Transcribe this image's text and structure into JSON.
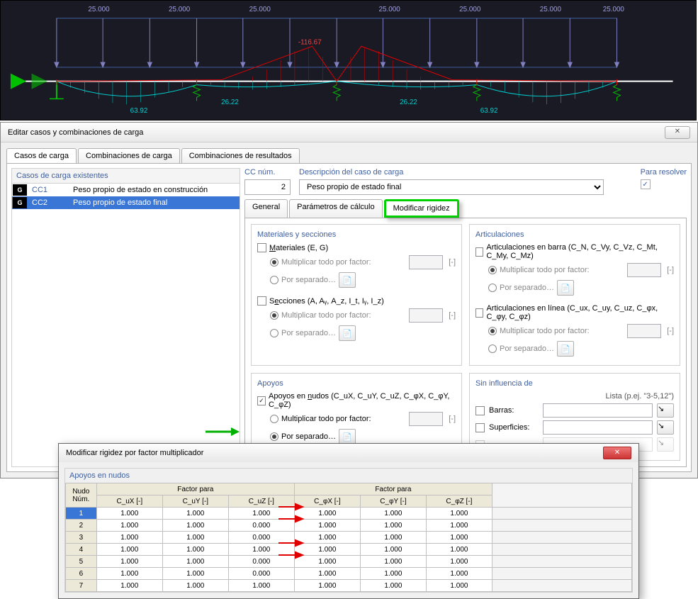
{
  "viewport": {
    "load_labels": [
      "25.000",
      "25.000",
      "25.000",
      "25.000",
      "25.000",
      "25.000",
      "25.000"
    ],
    "moment_peak": "-116.67",
    "deflect_vals": [
      "63.92",
      "26.22",
      "26.22",
      "63.92"
    ]
  },
  "dialog": {
    "title": "Editar casos y combinaciones de carga",
    "close": "✕",
    "tabs": {
      "t1": "Casos de carga",
      "t2": "Combinaciones de carga",
      "t3": "Combinaciones de resultados"
    },
    "left": {
      "header": "Casos de carga existentes",
      "rows": [
        {
          "tag": "G",
          "id": "CC1",
          "desc": "Peso propio de estado en construcción"
        },
        {
          "tag": "G",
          "id": "CC2",
          "desc": "Peso propio de estado final"
        }
      ]
    },
    "top": {
      "cc_num_label": "CC núm.",
      "cc_num": "2",
      "desc_label": "Descripción del caso de carga",
      "desc_value": "Peso propio de estado final",
      "solve_label": "Para resolver"
    },
    "subtabs": {
      "s1": "General",
      "s2": "Parámetros de cálculo",
      "s3": "Modificar rigidez"
    },
    "groups": {
      "mat": {
        "title": "Materiales y secciones",
        "chk1": "Materiales (E, G)",
        "r1": "Multiplicar todo por factor:",
        "r2": "Por separado…",
        "chk2": "Secciones (A, Aᵧ, A_z, I_t, Iᵧ, I_z)",
        "r3": "Multiplicar todo por factor:",
        "r4": "Por separado…"
      },
      "art": {
        "title": "Articulaciones",
        "chk1": "Articulaciones en barra  (C_N, C_Vy, C_Vz, C_Mt, C_My, C_Mz)",
        "r1": "Multiplicar todo por factor:",
        "r2": "Por separado…",
        "chk2": "Articulaciones en línea (C_ux, C_uy, C_uz, C_φx, C_φy, C_φz)",
        "r3": "Multiplicar todo por factor:",
        "r4": "Por separado…"
      },
      "ap": {
        "title": "Apoyos",
        "chk1": "Apoyos en nudos (C_uX, C_uY, C_uZ, C_φX, C_φY, C_φZ)",
        "r1": "Multiplicar todo por factor:",
        "r2": "Por separado…"
      },
      "sin": {
        "title": "Sin influencia de",
        "list_label": "Lista (p.ej. \"3-5,12\")",
        "barras": "Barras:",
        "superficies": "Superficies:"
      },
      "unit": "[-]"
    }
  },
  "modal2": {
    "title": "Modificar rigidez por factor multiplicador",
    "group_title": "Apoyos en nudos",
    "headers": {
      "node": "Nudo Núm.",
      "fp1": "Factor para",
      "fp2": "Factor para",
      "cols": [
        "C_uX [-]",
        "C_uY [-]",
        "C_uZ [-]",
        "C_φX [-]",
        "C_φY [-]",
        "C_φZ [-]"
      ]
    },
    "rows": [
      {
        "n": "1",
        "v": [
          "1.000",
          "1.000",
          "1.000",
          "1.000",
          "1.000",
          "1.000"
        ]
      },
      {
        "n": "2",
        "v": [
          "1.000",
          "1.000",
          "0.000",
          "1.000",
          "1.000",
          "1.000"
        ]
      },
      {
        "n": "3",
        "v": [
          "1.000",
          "1.000",
          "0.000",
          "1.000",
          "1.000",
          "1.000"
        ]
      },
      {
        "n": "4",
        "v": [
          "1.000",
          "1.000",
          "1.000",
          "1.000",
          "1.000",
          "1.000"
        ]
      },
      {
        "n": "5",
        "v": [
          "1.000",
          "1.000",
          "0.000",
          "1.000",
          "1.000",
          "1.000"
        ]
      },
      {
        "n": "6",
        "v": [
          "1.000",
          "1.000",
          "0.000",
          "1.000",
          "1.000",
          "1.000"
        ]
      },
      {
        "n": "7",
        "v": [
          "1.000",
          "1.000",
          "1.000",
          "1.000",
          "1.000",
          "1.000"
        ]
      }
    ]
  }
}
